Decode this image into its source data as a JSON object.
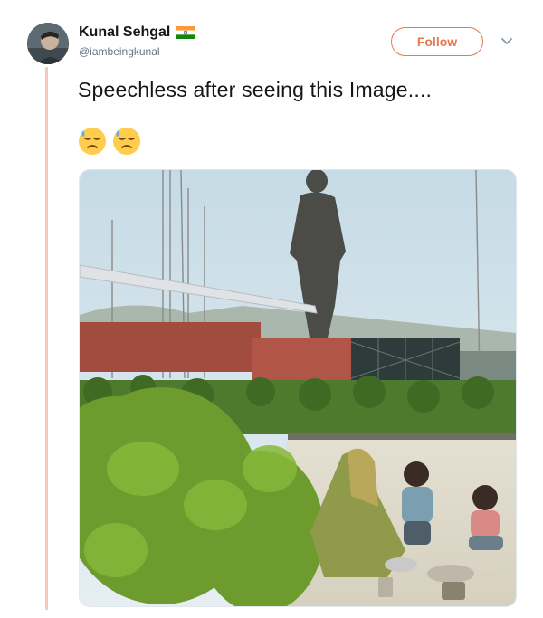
{
  "author": {
    "name": "Kunal Sehgal",
    "handle": "@iambeingkunal",
    "flag_icon": "india-flag-icon",
    "avatar_icon": "avatar"
  },
  "actions": {
    "follow_label": "Follow",
    "more_icon": "chevron-down-icon"
  },
  "tweet": {
    "text": "Speechless after seeing this Image....",
    "emojis": [
      "downcast-face-with-sweat-emoji",
      "downcast-face-with-sweat-emoji"
    ]
  },
  "media": {
    "type": "photo",
    "subject": "statue-with-children-eating-on-ground"
  },
  "colors": {
    "accent": "#e8784f",
    "thread_line": "#f6c9b8",
    "name": "#14171a",
    "handle": "#657786"
  }
}
